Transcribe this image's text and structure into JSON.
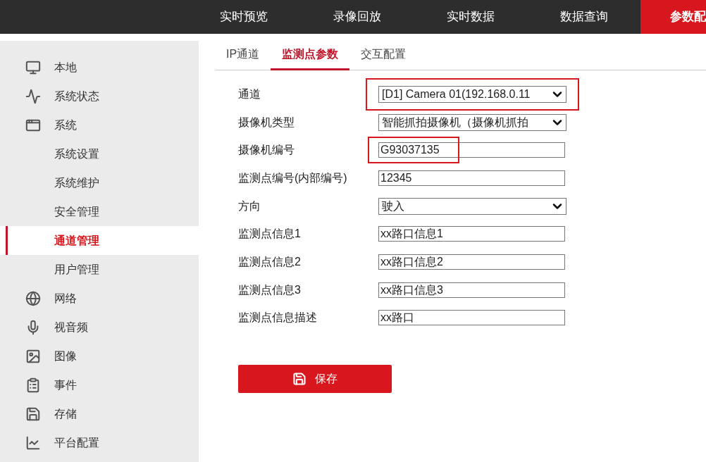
{
  "top_nav": [
    {
      "label": "实时预览",
      "selected": false
    },
    {
      "label": "录像回放",
      "selected": false
    },
    {
      "label": "实时数据",
      "selected": false
    },
    {
      "label": "数据查询",
      "selected": false
    },
    {
      "label": "参数配",
      "selected": true
    }
  ],
  "sidebar": {
    "items": [
      {
        "label": "本地",
        "selected": false
      },
      {
        "label": "系统状态",
        "selected": false
      },
      {
        "label": "系统",
        "selected": false,
        "children": [
          {
            "label": "系统设置",
            "selected": false
          },
          {
            "label": "系统维护",
            "selected": false
          },
          {
            "label": "安全管理",
            "selected": false
          },
          {
            "label": "通道管理",
            "selected": true
          },
          {
            "label": "用户管理",
            "selected": false
          }
        ]
      },
      {
        "label": "网络",
        "selected": false
      },
      {
        "label": "视音频",
        "selected": false
      },
      {
        "label": "图像",
        "selected": false
      },
      {
        "label": "事件",
        "selected": false
      },
      {
        "label": "存储",
        "selected": false
      },
      {
        "label": "平台配置",
        "selected": false
      }
    ]
  },
  "tabs": [
    {
      "label": "IP通道",
      "selected": false
    },
    {
      "label": "监测点参数",
      "selected": true
    },
    {
      "label": "交互配置",
      "selected": false
    }
  ],
  "form": [
    {
      "label": "通道",
      "kind": "select",
      "value": "[D1] Camera 01(192.168.0.11",
      "highlighted": true
    },
    {
      "label": "摄像机类型",
      "kind": "select",
      "value": "智能抓拍摄像机（摄像机抓拍",
      "highlighted": false
    },
    {
      "label": "摄像机编号",
      "kind": "text",
      "value": "G93037135",
      "highlighted": true
    },
    {
      "label": "监测点编号(内部编号)",
      "kind": "text",
      "value": "12345",
      "highlighted": false
    },
    {
      "label": "方向",
      "kind": "select",
      "value": "驶入",
      "highlighted": false
    },
    {
      "label": "监测点信息1",
      "kind": "text",
      "value": "xx路口信息1",
      "highlighted": false
    },
    {
      "label": "监测点信息2",
      "kind": "text",
      "value": "xx路口信息2",
      "highlighted": false
    },
    {
      "label": "监测点信息3",
      "kind": "text",
      "value": "xx路口信息3",
      "highlighted": false
    },
    {
      "label": "监测点信息描述",
      "kind": "text",
      "value": "xx路口",
      "highlighted": false
    }
  ],
  "save_button": {
    "label": "保存"
  }
}
